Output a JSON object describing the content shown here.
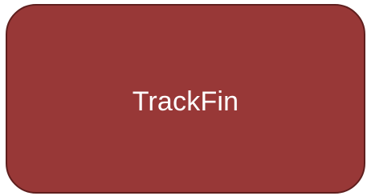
{
  "tile": {
    "label": "TrackFin"
  },
  "colors": {
    "fill": "#983837",
    "border": "#5f1f1e",
    "text": "#ffffff",
    "background": "#ffffff"
  }
}
